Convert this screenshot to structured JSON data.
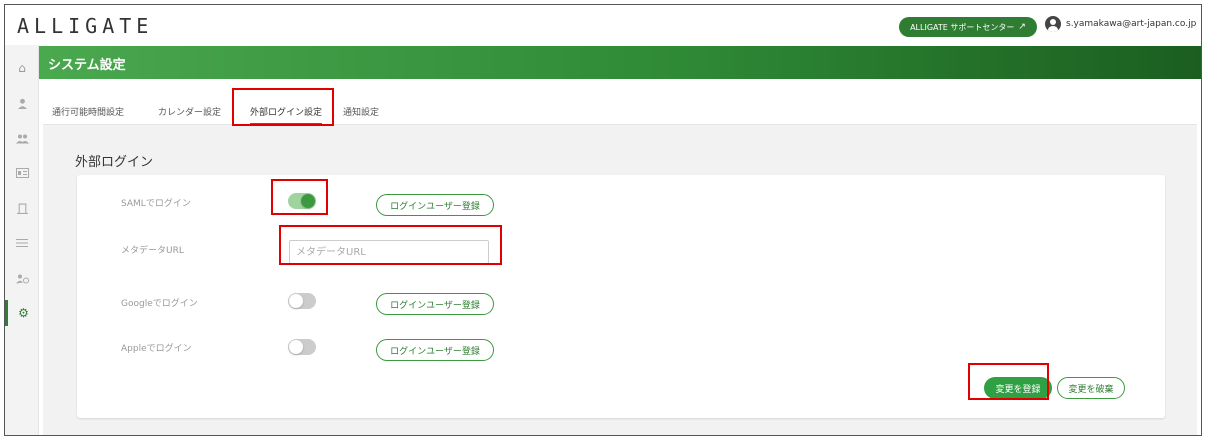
{
  "app": {
    "logo": "ALLIGATE"
  },
  "header": {
    "support_label": "ALLIGATE サポートセンター",
    "user_email": "s.yamakawa@art-japan.co.jp"
  },
  "sidebar": {
    "items": [
      {
        "icon": "home-icon"
      },
      {
        "icon": "user-icon"
      },
      {
        "icon": "users-icon"
      },
      {
        "icon": "id-card-icon"
      },
      {
        "icon": "door-icon"
      },
      {
        "icon": "list-icon"
      },
      {
        "icon": "user-clock-icon"
      },
      {
        "icon": "gear-icon",
        "active": true
      }
    ]
  },
  "page": {
    "title": "システム設定"
  },
  "tabs": [
    {
      "label": "通行可能時間設定"
    },
    {
      "label": "カレンダー設定"
    },
    {
      "label": "外部ログイン設定",
      "active": true
    },
    {
      "label": "通知設定"
    }
  ],
  "section": {
    "title": "外部ログイン"
  },
  "rows": {
    "saml": {
      "label": "SAMLでログイン",
      "enabled": true,
      "button": "ログインユーザー登録"
    },
    "metadata": {
      "label": "メタデータURL",
      "placeholder": "メタデータURL",
      "value": ""
    },
    "google": {
      "label": "Googleでログイン",
      "enabled": false,
      "button": "ログインユーザー登録"
    },
    "apple": {
      "label": "Appleでログイン",
      "enabled": false,
      "button": "ログインユーザー登録"
    }
  },
  "actions": {
    "save": "変更を登録",
    "discard": "変更を破棄"
  },
  "colors": {
    "accent": "#2e7d32",
    "highlight": "#e00000"
  }
}
